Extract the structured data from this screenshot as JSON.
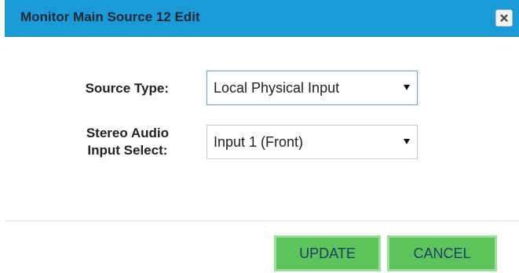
{
  "dialog": {
    "title": "Monitor Main Source 12 Edit",
    "close_icon": "close-icon",
    "accent_color": "#1a9ad6"
  },
  "form": {
    "source_type": {
      "label": "Source Type:",
      "selected": "Local Physical Input"
    },
    "stereo_audio_input": {
      "label_line1": "Stereo Audio",
      "label_line2": "Input Select:",
      "selected": "Input 1 (Front)"
    }
  },
  "footer": {
    "update_label": "UPDATE",
    "cancel_label": "CANCEL",
    "button_color": "#5cc45a"
  }
}
